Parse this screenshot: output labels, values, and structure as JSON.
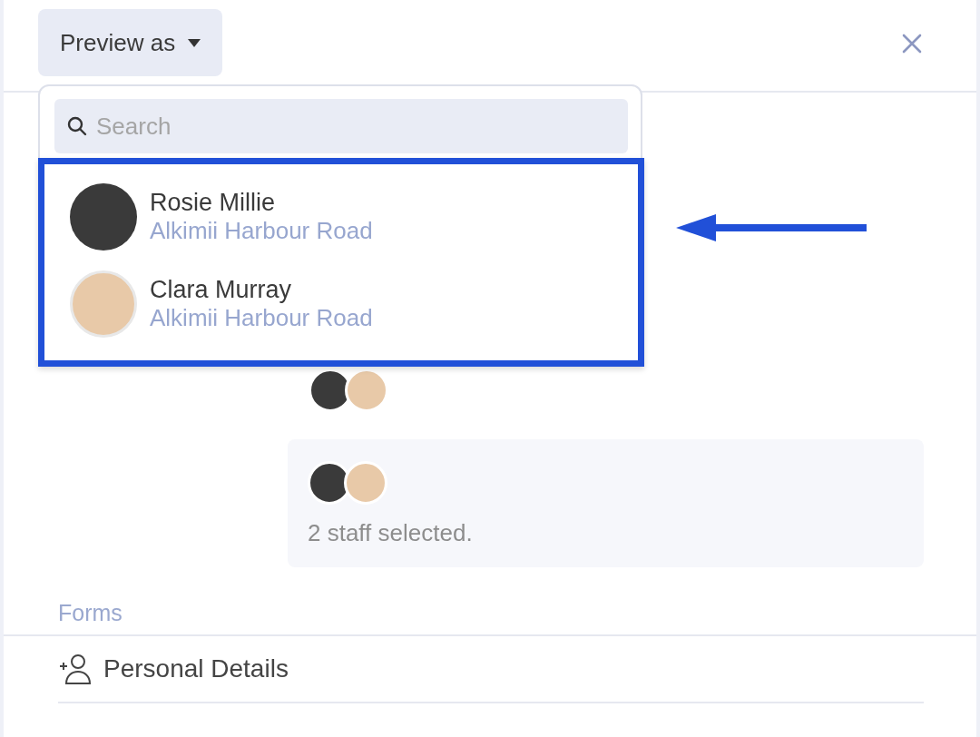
{
  "header": {
    "preview_button": "Preview as"
  },
  "dropdown": {
    "search": {
      "placeholder": "Search"
    },
    "staff": [
      {
        "name": "Rosie Millie",
        "location": "Alkimii Harbour Road"
      },
      {
        "name": "Clara Murray",
        "location": "Alkimii Harbour Road"
      }
    ]
  },
  "selection": {
    "summary": "2 staff selected."
  },
  "forms": {
    "label": "Forms",
    "items": [
      {
        "label": "Personal Details"
      }
    ]
  }
}
